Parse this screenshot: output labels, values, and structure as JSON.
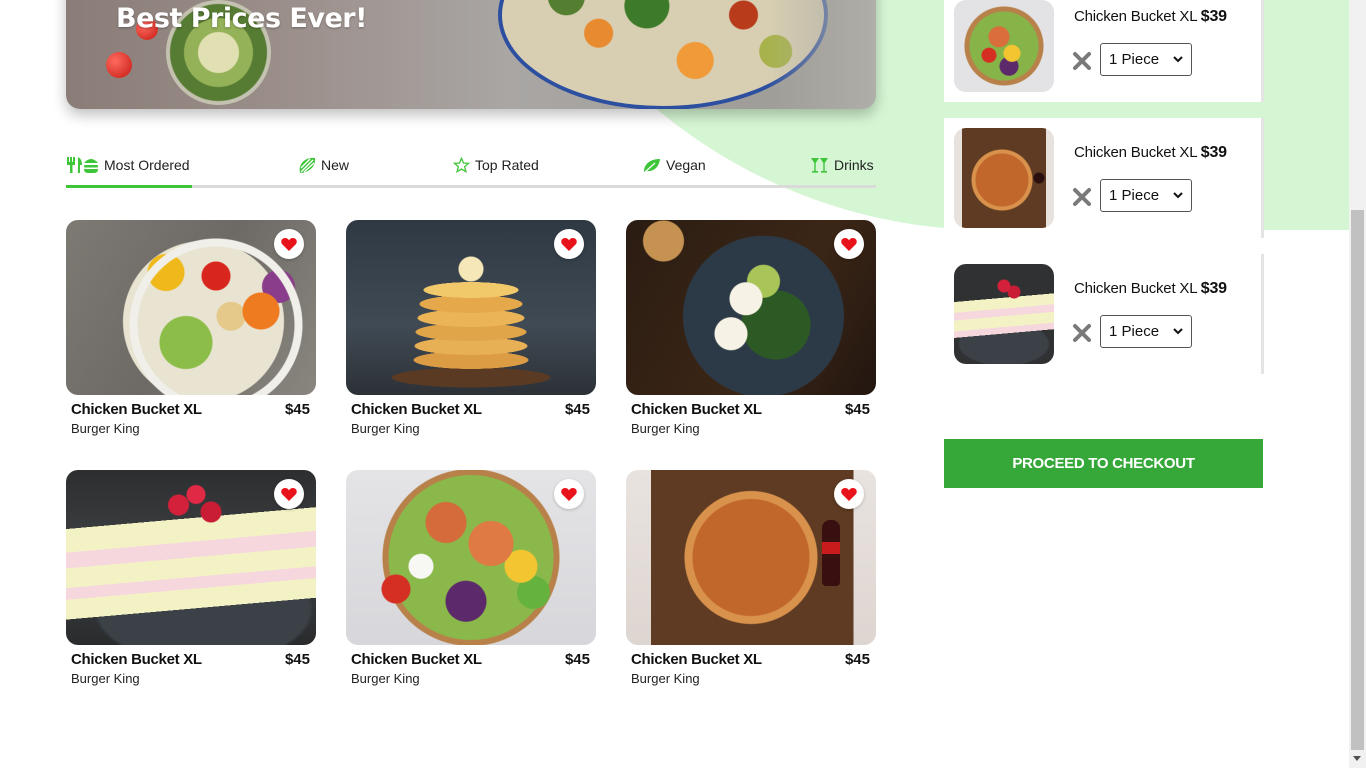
{
  "hero": {
    "title": "Best Prices Ever!"
  },
  "tabs": [
    {
      "label": "Most Ordered",
      "icon": "utensils-burger-icon",
      "active": true
    },
    {
      "label": "New",
      "icon": "leaf-stripe-icon",
      "active": false
    },
    {
      "label": "Top Rated",
      "icon": "star-outline-icon",
      "active": false
    },
    {
      "label": "Vegan",
      "icon": "leaf-icon",
      "active": false
    },
    {
      "label": "Drinks",
      "icon": "cocktail-icon",
      "active": false
    }
  ],
  "products": [
    {
      "name": "Chicken Bucket XL",
      "price": "$45",
      "vendor": "Burger King",
      "image": "salad-bowl",
      "favorite": true
    },
    {
      "name": "Chicken Bucket XL",
      "price": "$45",
      "vendor": "Burger King",
      "image": "pancake-stack",
      "favorite": true
    },
    {
      "name": "Chicken Bucket XL",
      "price": "$45",
      "vendor": "Burger King",
      "image": "egg-avocado-toast",
      "favorite": true
    },
    {
      "name": "Chicken Bucket XL",
      "price": "$45",
      "vendor": "Burger King",
      "image": "raspberry-cake",
      "favorite": true
    },
    {
      "name": "Chicken Bucket XL",
      "price": "$45",
      "vendor": "Burger King",
      "image": "salmon-bowl",
      "favorite": true
    },
    {
      "name": "Chicken Bucket XL",
      "price": "$45",
      "vendor": "Burger King",
      "image": "pizza-board",
      "favorite": true
    }
  ],
  "cart": {
    "items": [
      {
        "name": "Chicken Bucket XL",
        "price": "$39",
        "quantity": "1 Piece",
        "image": "salmon-bowl"
      },
      {
        "name": "Chicken Bucket XL",
        "price": "$39",
        "quantity": "1 Piece",
        "image": "pizza-board"
      },
      {
        "name": "Chicken Bucket XL",
        "price": "$39",
        "quantity": "1 Piece",
        "image": "raspberry-cake"
      }
    ],
    "checkout_label": "PROCEED TO CHECKOUT"
  },
  "colors": {
    "accent_green": "#3ec53a",
    "checkout_green": "#36a83a",
    "background_curve": "#d5f6d3",
    "favorite_red": "#e8121b"
  }
}
